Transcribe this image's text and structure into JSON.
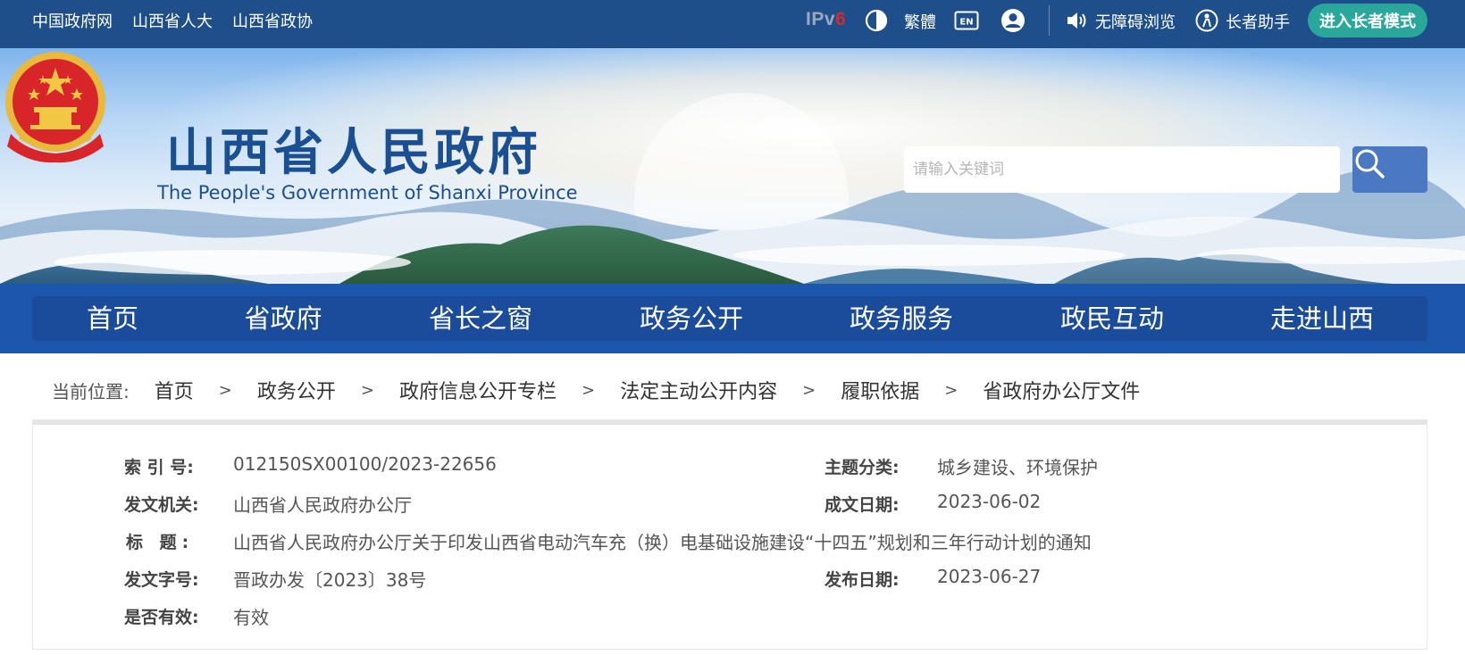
{
  "top_links": [
    "中国政府网",
    "山西省人大",
    "山西省政协"
  ],
  "toolbar": {
    "ipv6_prefix": "IPv",
    "ipv6_suffix": "6",
    "traditional": "繁體",
    "accessibility": "无障碍浏览",
    "elder_helper": "长者助手",
    "elder_mode": "进入长者模式"
  },
  "header": {
    "title": "山西省人民政府",
    "subtitle": "The People's Government of Shanxi Province"
  },
  "search": {
    "placeholder": "请输入关键词",
    "value": ""
  },
  "nav": [
    "首页",
    "省政府",
    "省长之窗",
    "政务公开",
    "政务服务",
    "政民互动",
    "走进山西"
  ],
  "breadcrumb": {
    "label": "当前位置:",
    "items": [
      "首页",
      "政务公开",
      "政府信息公开专栏",
      "法定主动公开内容",
      "履职依据",
      "省政府办公厅文件"
    ]
  },
  "info": {
    "index_label": "索 引 号:",
    "index_value": "012150SX00100/2023-22656",
    "topic_label": "主题分类:",
    "topic_value": "城乡建设、环境保护",
    "issuer_label": "发文机关:",
    "issuer_value": "山西省人民政府办公厅",
    "date_label": "成文日期:",
    "date_value": "2023-06-02",
    "title_label": "标 题:",
    "title_value": "山西省人民政府办公厅关于印发山西省电动汽车充（换）电基础设施建设“十四五”规划和三年行动计划的通知",
    "docno_label": "发文字号:",
    "docno_value": "晋政办发〔2023〕38号",
    "pubdate_label": "发布日期:",
    "pubdate_value": "2023-06-27",
    "valid_label": "是否有效:",
    "valid_value": "有效"
  },
  "colors": {
    "topbar": "#1f4f8b",
    "nav": "#1d56ad",
    "title_blue": "#1b4f93",
    "elder_button": "#2aa79b",
    "search_button": "#4a78c2"
  }
}
